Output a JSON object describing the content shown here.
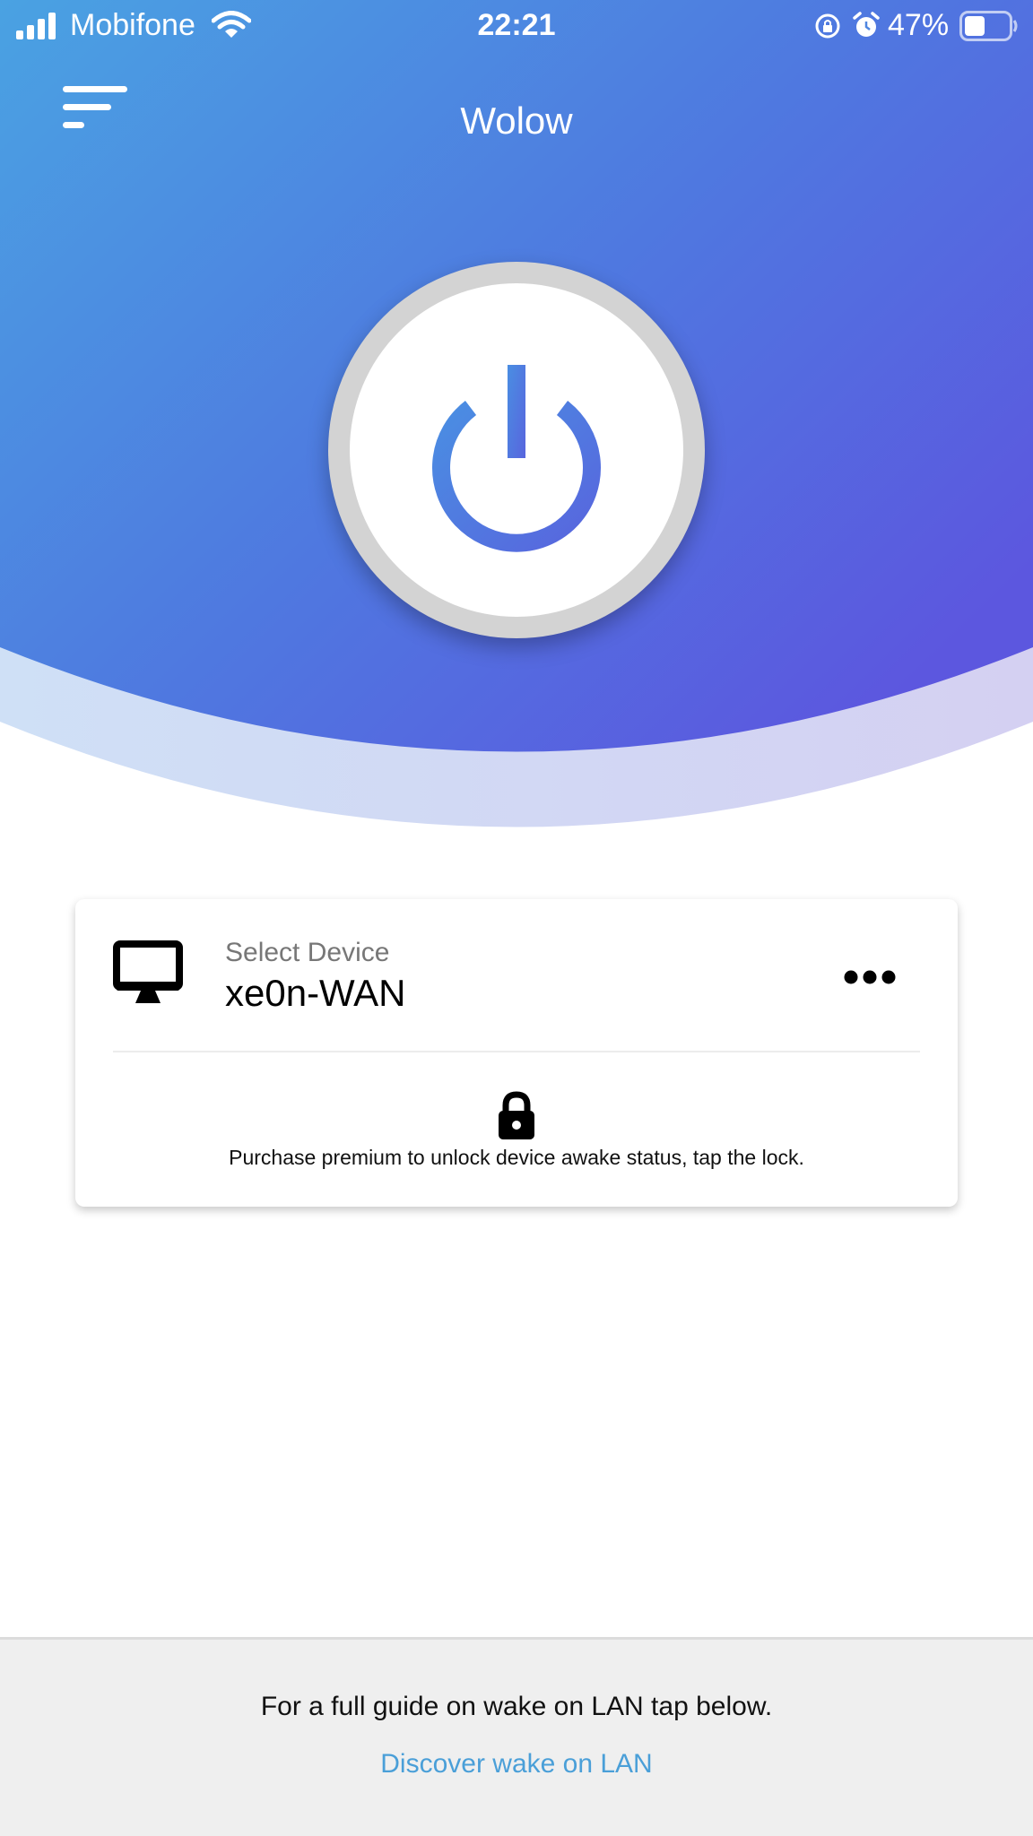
{
  "status_bar": {
    "carrier": "Mobifone",
    "time": "22:21",
    "battery_percent": "47%",
    "icons": [
      "signal-bars-icon",
      "wifi-icon",
      "orientation-lock-icon",
      "alarm-icon",
      "battery-icon"
    ]
  },
  "header": {
    "title": "Wolow",
    "menu_icon": "menu-icon"
  },
  "power_button": {
    "icon": "power-icon"
  },
  "device_card": {
    "icon": "desktop-monitor-icon",
    "caption": "Select Device",
    "device_name": "xe0n-WAN",
    "more_icon": "more-dots-icon",
    "lock_icon": "lock-icon",
    "premium_message": "Purchase premium to unlock device awake status, tap the lock."
  },
  "footer": {
    "guide_text": "For a full guide on wake on LAN tap below.",
    "link_label": "Discover wake on LAN"
  },
  "colors": {
    "gradient_start": "#4a9fe0",
    "gradient_end": "#5a56df",
    "accent_blue": "#4a7fe0",
    "link": "#4a9fd8",
    "footer_bg": "#efefef"
  }
}
